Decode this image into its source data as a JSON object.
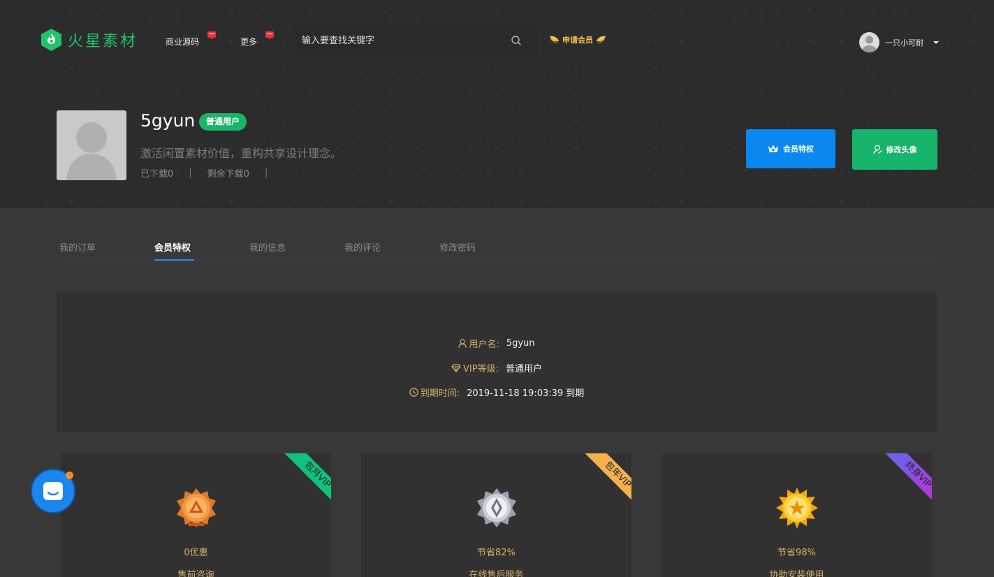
{
  "header": {
    "logo_text": "火星素材",
    "nav": [
      {
        "label": "商业源码"
      },
      {
        "label": "更多"
      }
    ],
    "search": {
      "placeholder": "输入要查找关键字"
    },
    "apply_vip": "申请会员",
    "user": {
      "name": "一只小可耐"
    }
  },
  "profile": {
    "username": "5gyun",
    "badge": "普通用户",
    "motto": "激活闲置素材价值，重构共享设计理念。",
    "downloaded": "已下载0",
    "remaining": "剩余下载0",
    "buttons": {
      "vip": "会员特权",
      "avatar": "修改头像"
    }
  },
  "tabs": [
    {
      "label": "我的订单"
    },
    {
      "label": "会员特权"
    },
    {
      "label": "我的信息"
    },
    {
      "label": "我的评论"
    },
    {
      "label": "修改密码"
    }
  ],
  "active_tab": "会员特权",
  "member_info": {
    "username_label": "用户名:",
    "username_value": "5gyun",
    "level_label": "VIP等级:",
    "level_value": "普通用户",
    "expire_label": "到期时间:",
    "expire_value": "2019-11-18 19:03:39 到期"
  },
  "plans": [
    {
      "ribbon": "包月VIP",
      "saving": "0优惠",
      "service": "售前咨询"
    },
    {
      "ribbon": "包年VIP",
      "saving": "节省82%",
      "service": "在线售后服务"
    },
    {
      "ribbon": "终身VIP",
      "saving": "节省98%",
      "service": "协助安装使用"
    }
  ],
  "colors": {
    "brand_green": "#22c36a",
    "primary_blue": "#0a88f0",
    "gold_text": "#d4b06a",
    "monthly_ribbon": "#0fc47a",
    "yearly_ribbon": "#f3b04c",
    "lifetime_ribbon_from": "#5a6cf0",
    "lifetime_ribbon_to": "#cc28d8",
    "badge_red": "#e8323c"
  }
}
